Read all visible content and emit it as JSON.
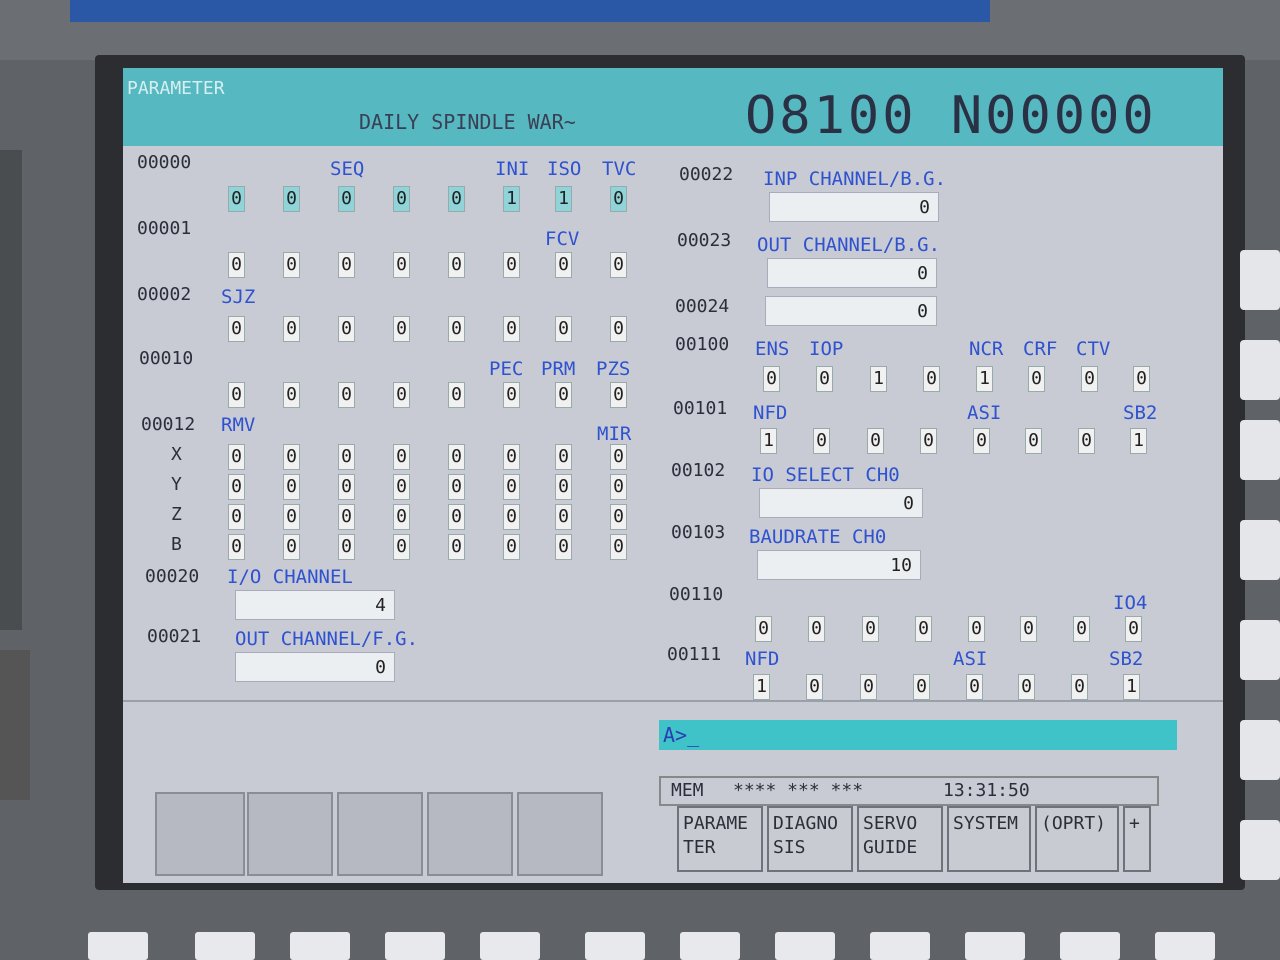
{
  "header": {
    "mode": "PARAMETER",
    "program_comment": "DAILY SPINDLE WAR~",
    "program_number": "O8100 N00000"
  },
  "left": {
    "p00000": {
      "num": "00000",
      "names": [
        "",
        "",
        "SEQ",
        "",
        "",
        "INI",
        "ISO",
        "TVC"
      ],
      "bits": [
        "0",
        "0",
        "0",
        "0",
        "0",
        "1",
        "1",
        "0"
      ]
    },
    "p00001": {
      "num": "00001",
      "names": [
        "",
        "",
        "",
        "",
        "",
        "",
        "FCV",
        ""
      ],
      "bits": [
        "0",
        "0",
        "0",
        "0",
        "0",
        "0",
        "0",
        "0"
      ]
    },
    "p00002": {
      "num": "00002",
      "names": [
        "SJZ",
        "",
        "",
        "",
        "",
        "",
        "",
        ""
      ],
      "bits": [
        "0",
        "0",
        "0",
        "0",
        "0",
        "0",
        "0",
        "0"
      ]
    },
    "p00010": {
      "num": "00010",
      "names": [
        "",
        "",
        "",
        "",
        "",
        "PEC",
        "PRM",
        "PZS"
      ],
      "bits": [
        "0",
        "0",
        "0",
        "0",
        "0",
        "0",
        "0",
        "0"
      ]
    },
    "p00012": {
      "num": "00012",
      "names": [
        "RMV",
        "",
        "",
        "",
        "",
        "",
        "",
        "MIR"
      ],
      "axes": [
        {
          "axis": "X",
          "bits": [
            "0",
            "0",
            "0",
            "0",
            "0",
            "0",
            "0",
            "0"
          ]
        },
        {
          "axis": "Y",
          "bits": [
            "0",
            "0",
            "0",
            "0",
            "0",
            "0",
            "0",
            "0"
          ]
        },
        {
          "axis": "Z",
          "bits": [
            "0",
            "0",
            "0",
            "0",
            "0",
            "0",
            "0",
            "0"
          ]
        },
        {
          "axis": "B",
          "bits": [
            "0",
            "0",
            "0",
            "0",
            "0",
            "0",
            "0",
            "0"
          ]
        }
      ]
    },
    "p00020": {
      "num": "00020",
      "name": "I/O CHANNEL",
      "value": "4"
    },
    "p00021": {
      "num": "00021",
      "name": "OUT CHANNEL/F.G.",
      "value": "0"
    }
  },
  "right": {
    "p00022": {
      "num": "00022",
      "name": "INP CHANNEL/B.G.",
      "value": "0"
    },
    "p00023": {
      "num": "00023",
      "name": "OUT CHANNEL/B.G.",
      "value": "0"
    },
    "p00024": {
      "num": "00024",
      "value": "0"
    },
    "p00100": {
      "num": "00100",
      "names": [
        "ENS",
        "IOP",
        "",
        "",
        "NCR",
        "CRF",
        "CTV",
        ""
      ],
      "bits": [
        "0",
        "0",
        "1",
        "0",
        "1",
        "0",
        "0",
        "0"
      ]
    },
    "p00101": {
      "num": "00101",
      "names": [
        "NFD",
        "",
        "",
        "",
        "ASI",
        "",
        "",
        "SB2"
      ],
      "bits": [
        "1",
        "0",
        "0",
        "0",
        "0",
        "0",
        "0",
        "1"
      ]
    },
    "p00102": {
      "num": "00102",
      "name": "IO SELECT CH0",
      "value": "0"
    },
    "p00103": {
      "num": "00103",
      "name": "BAUDRATE CH0",
      "value": "10"
    },
    "p00110": {
      "num": "00110",
      "names": [
        "",
        "",
        "",
        "",
        "",
        "",
        "",
        "IO4"
      ],
      "bits": [
        "0",
        "0",
        "0",
        "0",
        "0",
        "0",
        "0",
        "0"
      ]
    },
    "p00111": {
      "num": "00111",
      "names": [
        "NFD",
        "",
        "",
        "",
        "ASI",
        "",
        "",
        "SB2"
      ],
      "bits": [
        "1",
        "0",
        "0",
        "0",
        "0",
        "0",
        "0",
        "1"
      ]
    }
  },
  "input_prompt": "A>_",
  "status": {
    "mode": "MEM",
    "stars": "**** *** ***",
    "time": "13:31:50"
  },
  "softkeys": [
    {
      "label": "PARAME\nTER"
    },
    {
      "label": "DIAGNO\nSIS"
    },
    {
      "label": "SERVO\nGUIDE"
    },
    {
      "label": "SYSTEM"
    },
    {
      "label": "(OPRT)"
    },
    {
      "label": "+"
    }
  ]
}
